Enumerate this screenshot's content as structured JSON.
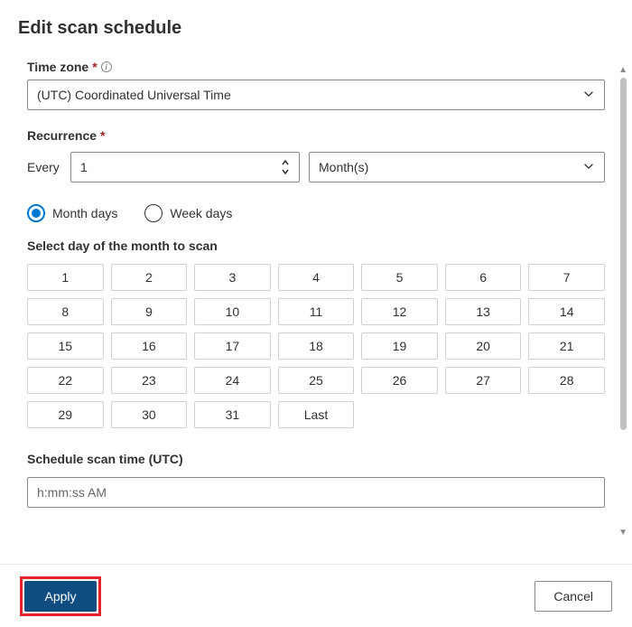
{
  "header": {
    "title": "Edit scan schedule"
  },
  "timezone": {
    "label": "Time zone",
    "required": "*",
    "value": "(UTC) Coordinated Universal Time"
  },
  "recurrence": {
    "label": "Recurrence",
    "required": "*",
    "every_label": "Every",
    "every_value": "1",
    "unit_value": "Month(s)"
  },
  "dayType": {
    "month_days": "Month days",
    "week_days": "Week days",
    "selected": "month_days"
  },
  "daySelect": {
    "label": "Select day of the month to scan",
    "days": [
      "1",
      "2",
      "3",
      "4",
      "5",
      "6",
      "7",
      "8",
      "9",
      "10",
      "11",
      "12",
      "13",
      "14",
      "15",
      "16",
      "17",
      "18",
      "19",
      "20",
      "21",
      "22",
      "23",
      "24",
      "25",
      "26",
      "27",
      "28",
      "29",
      "30",
      "31",
      "Last"
    ]
  },
  "scanTime": {
    "label": "Schedule scan time (UTC)",
    "placeholder": "h:mm:ss AM"
  },
  "footer": {
    "apply": "Apply",
    "cancel": "Cancel"
  }
}
